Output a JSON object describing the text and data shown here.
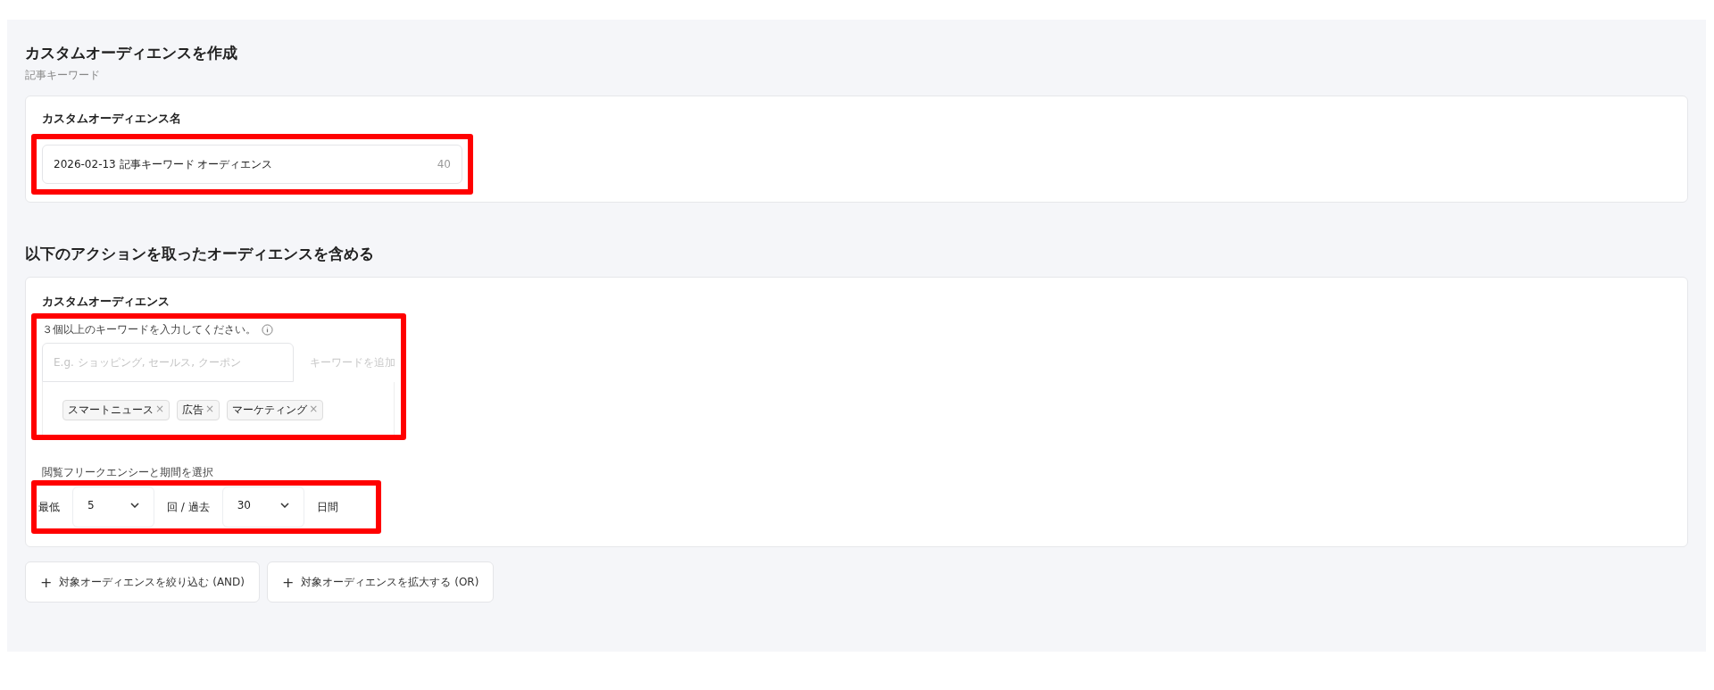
{
  "header": {
    "title": "カスタムオーディエンスを作成",
    "subtitle": "記事キーワード"
  },
  "name_card": {
    "label": "カスタムオーディエンス名",
    "highlighted": true,
    "field": {
      "value": "2026-02-13 記事キーワード オーディエンス",
      "counter": "40"
    }
  },
  "section_title": "以下のアクションを取ったオーディエンスを含める",
  "audience_card": {
    "label": "カスタムオーディエンス",
    "keywords": {
      "highlighted": true,
      "hint": "３個以上のキーワードを入力してください。",
      "placeholder": "E.g. ショッピング, セールス, クーポン",
      "add_label": "キーワードを追加",
      "tags": [
        {
          "text": "スマートニュース",
          "remove": "×"
        },
        {
          "text": "広告",
          "remove": "×"
        },
        {
          "text": "マーケティング",
          "remove": "×"
        }
      ]
    },
    "frequency": {
      "label": "閲覧フリークエンシーと期間を選択",
      "highlighted": true,
      "prefix": "最低",
      "count": "5",
      "middle": "回 / 過去",
      "days": "30",
      "suffix": "日間"
    }
  },
  "buttons": [
    {
      "icon": "+",
      "label": "対象オーディエンスを絞り込む (AND)"
    },
    {
      "icon": "+",
      "label": "対象オーディエンスを拡大する (OR)"
    }
  ]
}
